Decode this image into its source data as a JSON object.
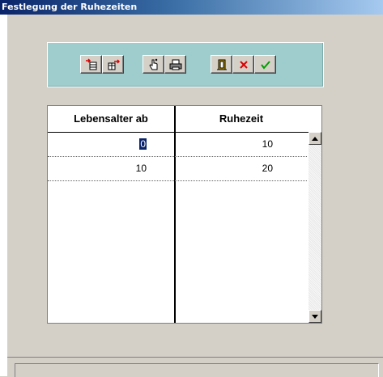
{
  "window": {
    "title": "Festlegung der Ruhezeiten"
  },
  "toolbar": {
    "buttons": [
      {
        "name": "insert-row-icon"
      },
      {
        "name": "delete-row-icon"
      },
      {
        "name": "hand-pointer-icon"
      },
      {
        "name": "printer-icon"
      },
      {
        "name": "exit-door-icon"
      },
      {
        "name": "cancel-x-icon",
        "color": "#e00000"
      },
      {
        "name": "confirm-check-icon",
        "color": "#00a000"
      }
    ]
  },
  "table": {
    "columns": [
      "Lebensalter ab",
      "Ruhezeit"
    ],
    "rows": [
      {
        "lebensalter_ab": "0",
        "ruhezeit": "10"
      },
      {
        "lebensalter_ab": "10",
        "ruhezeit": "20"
      }
    ]
  },
  "status": {
    "text": ""
  }
}
